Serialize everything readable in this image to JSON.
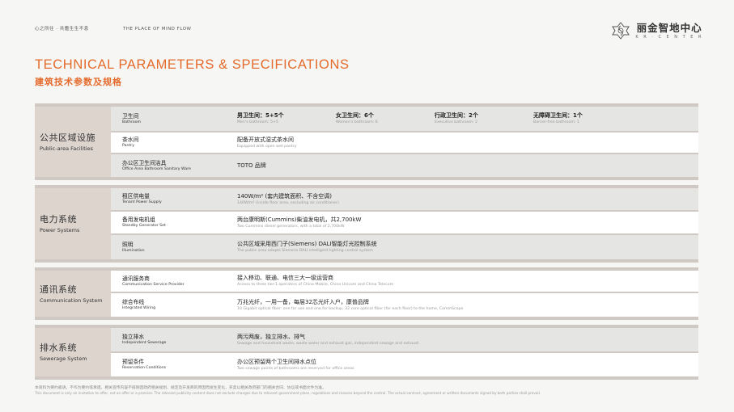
{
  "header": {
    "slogan": "心之所往 · 共鑑生生不息",
    "tagline": "THE PLACE OF MIND FLOW",
    "logo_cn": "丽金智地中心",
    "logo_en": "K R · C E N T E R"
  },
  "title": {
    "en": "TECHNICAL PARAMETERS & SPECIFICATIONS",
    "cn": "建筑技术参数及规格"
  },
  "sections": [
    {
      "cn": "公共区域设施",
      "en": "Public-area Facilities",
      "rows": [
        {
          "label_cn": "卫生间",
          "label_en": "Bathroom",
          "cells": [
            {
              "cn": "男卫生间：5+5个",
              "en": "Men's bathroom: 5+5"
            },
            {
              "cn": "女卫生间：6个",
              "en": "Women's bathroom: 6"
            },
            {
              "cn": "行政卫生间：2个",
              "en": "Executive bathroom: 2"
            },
            {
              "cn": "无障碍卫生间：1个",
              "en": "Barrier-free bathroom: 1"
            }
          ]
        },
        {
          "label_cn": "茶水间",
          "label_en": "Pantry",
          "value_cn": "配备开放式湿式茶水间",
          "value_en": "Equipped with open wet pantry"
        },
        {
          "label_cn": "办公区卫生间洁具",
          "label_en": "Office Area Bathroom Sanitary Ware",
          "value_cn": "TOTO 品牌",
          "value_en": ""
        }
      ]
    },
    {
      "cn": "电力系统",
      "en": "Power Systems",
      "rows": [
        {
          "label_cn": "租区供电量",
          "label_en": "Tenant Power Supply",
          "value_cn": "140W/m² (套内建筑面积、不含空调)",
          "value_en": "140W/m² (inside floor area, excluding air conditioner)"
        },
        {
          "label_cn": "备用发电机组",
          "label_en": "Standby Generator Set",
          "value_cn": "两台康明斯(Cummins)柴油发电机，共2,700kW",
          "value_en": "Two Cummins diesel generators, with a total of 2,700kW"
        },
        {
          "label_cn": "照明",
          "label_en": "Illumination",
          "value_cn": "公共区域采用西门子(Siemens) DALI智能灯光控制系统",
          "value_en": "The public area adopts Siemens DALI intelligent lighting control system"
        }
      ]
    },
    {
      "cn": "通讯系统",
      "en": "Communication System",
      "rows": [
        {
          "label_cn": "通讯服务商",
          "label_en": "Communication Service Provider",
          "value_cn": "接入移动、联通、电信三大一级运营商",
          "value_en": "Access to three tier-1 operators of China Mobile, China Unicom and China Telecom"
        },
        {
          "label_cn": "综合布线",
          "label_en": "Integrated Wiring",
          "value_cn": "万兆光纤，一用一备，每层32芯光纤入户，康普品牌",
          "value_en": "10 Gigabit optical fiber: one for use and one for backup, 32 core optical fiber (for each floor) to the home, CommScope"
        }
      ]
    },
    {
      "cn": "排水系统",
      "en": "Sewerage System",
      "rows": [
        {
          "label_cn": "独立排水",
          "label_en": "Independent Sewerage",
          "value_cn": "两污两废，独立排水、排气",
          "value_en": "Sewage and household waste, waste water and exhaust gas, independent sewage and exhaust"
        },
        {
          "label_cn": "预留条件",
          "label_en": "Reservation Conditions",
          "value_cn": "办公区预留两个卫生间排水点位",
          "value_en": "Two sewage points of bathrooms are reserved for office areas"
        }
      ]
    }
  ],
  "disclaimer": {
    "cn": "本资料为要约邀请，不作为要约或承诺。相关宣传内容不排除因政府相关规划、规定及开发商的原因而发生变化，买卖以相关政府部门的相关合同、协议或书面文件为准。",
    "en": "This document is only an invitation to offer, not an offer or a promise. The relevant publicity content does not exclude changes due to relevant government plans, regulations and reasons beyond the control. The actual contract, agreement or written documents signed by both parties shall prevail."
  }
}
